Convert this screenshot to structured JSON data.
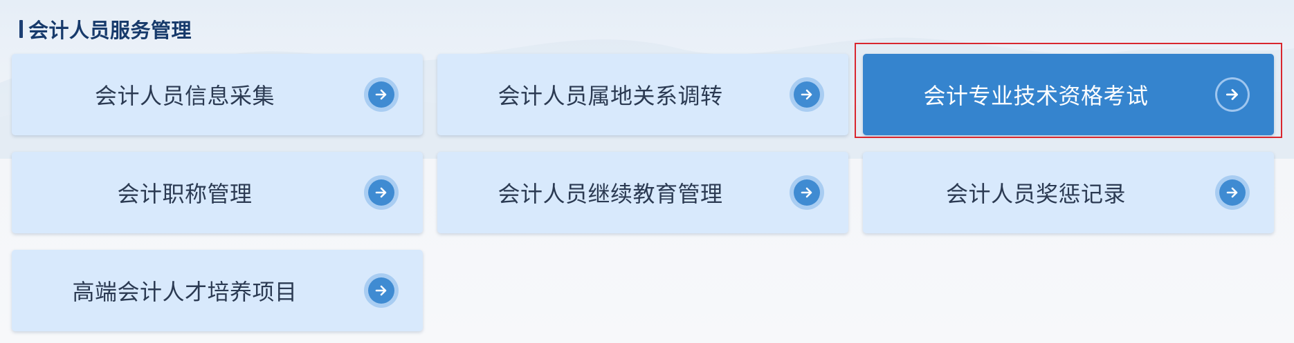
{
  "section": {
    "title": "会计人员服务管理"
  },
  "cards": [
    {
      "label": "会计人员信息采集"
    },
    {
      "label": "会计人员属地关系调转"
    },
    {
      "label": "会计专业技术资格考试"
    },
    {
      "label": "会计职称管理"
    },
    {
      "label": "会计人员继续教育管理"
    },
    {
      "label": "会计人员奖惩记录"
    },
    {
      "label": "高端会计人才培养项目"
    }
  ],
  "colors": {
    "card_bg": "#d8e9fc",
    "card_active_bg": "#3584ce",
    "arrow_circle": "#3f8bd2",
    "title": "#173a6b",
    "highlight_frame": "#d9262e"
  },
  "icons": {
    "card_arrow": "arrow-right-circle-icon"
  }
}
